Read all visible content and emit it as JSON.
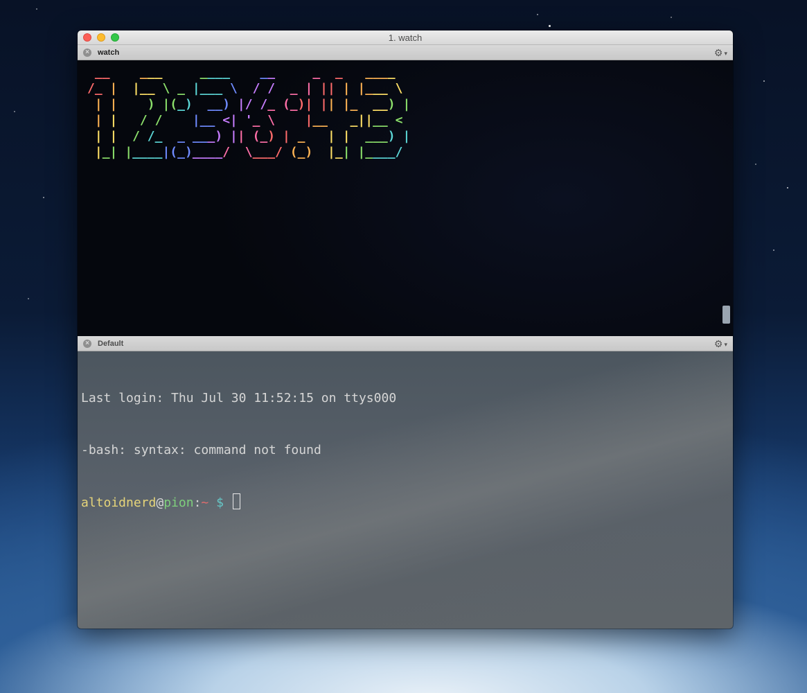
{
  "window": {
    "title": "1. watch"
  },
  "panes": {
    "top": {
      "tab_label": "watch",
      "close_icon": "close-icon",
      "settings_icon": "gear-icon"
    },
    "bottom": {
      "tab_label": "Default",
      "close_icon": "close-icon",
      "settings_icon": "gear-icon"
    }
  },
  "clock": {
    "time_text": "12:36:43",
    "rows": [
      " __    ___     ____    __     _  _   ____",
      "/_ |  |__ \\ _ |___ \\  / /  _ | || | |___ \\",
      " | |    ) |(_)  __) |/ /_ (_)| || |_  __) |",
      " | |   / /    |__ <| '_ \\    |__   _||__ <",
      " | |  / /_  _ ___) || (_) | _   | |  ___) |",
      " |_| |____|(_)____/  \\___/ (_)  |_| |____/"
    ],
    "colors": [
      "#ff6b6b",
      "#ffb454",
      "#ffe066",
      "#8ce06b",
      "#5cd6d6",
      "#6f8bff",
      "#c77dff",
      "#ff6fa8"
    ]
  },
  "terminal": {
    "line1": "Last login: Thu Jul 30 11:52:15 on ttys000",
    "line2": "-bash: syntax: command not found",
    "prompt": {
      "user": "altoidnerd",
      "at": "@",
      "host": "pion",
      "colon": ":",
      "path": "~",
      "dollar": " $ "
    }
  }
}
